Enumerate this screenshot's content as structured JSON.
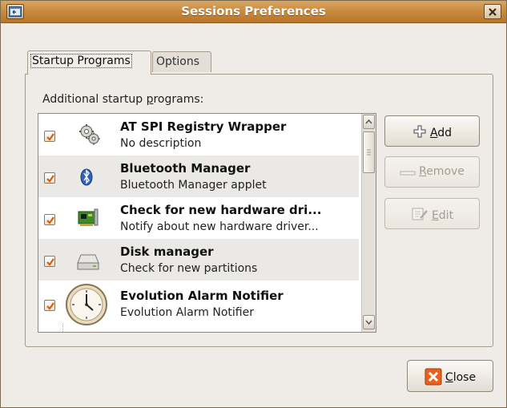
{
  "window": {
    "title": "Sessions Preferences",
    "accent_color": "#c98a3e"
  },
  "tabs": [
    {
      "label": "Startup Programs",
      "active": true
    },
    {
      "label": "Options",
      "active": false
    }
  ],
  "section": {
    "label_prefix": "Additional startup ",
    "label_mnemonic": "p",
    "label_suffix": "rograms:"
  },
  "programs": [
    {
      "title": "AT SPI Registry Wrapper",
      "description": "No description",
      "enabled": true,
      "icon": "gears-icon"
    },
    {
      "title": "Bluetooth Manager",
      "description": "Bluetooth Manager applet",
      "enabled": true,
      "icon": "bluetooth-icon"
    },
    {
      "title": "Check for new hardware dri...",
      "description": "Notify about new hardware driver...",
      "enabled": true,
      "icon": "hardware-card-icon"
    },
    {
      "title": "Disk manager",
      "description": "Check for new partitions",
      "enabled": true,
      "icon": "disk-drive-icon"
    },
    {
      "title": "Evolution Alarm Notifier",
      "description": "Evolution Alarm Notifier",
      "enabled": true,
      "icon": "clock-icon"
    }
  ],
  "buttons": {
    "add": {
      "mnemonic": "A",
      "rest": "dd",
      "enabled": true
    },
    "remove": {
      "mnemonic": "R",
      "rest": "emove",
      "enabled": false
    },
    "edit": {
      "mnemonic": "E",
      "rest": "dit",
      "enabled": false
    },
    "close": {
      "mnemonic": "C",
      "rest": "lose",
      "enabled": true
    }
  }
}
